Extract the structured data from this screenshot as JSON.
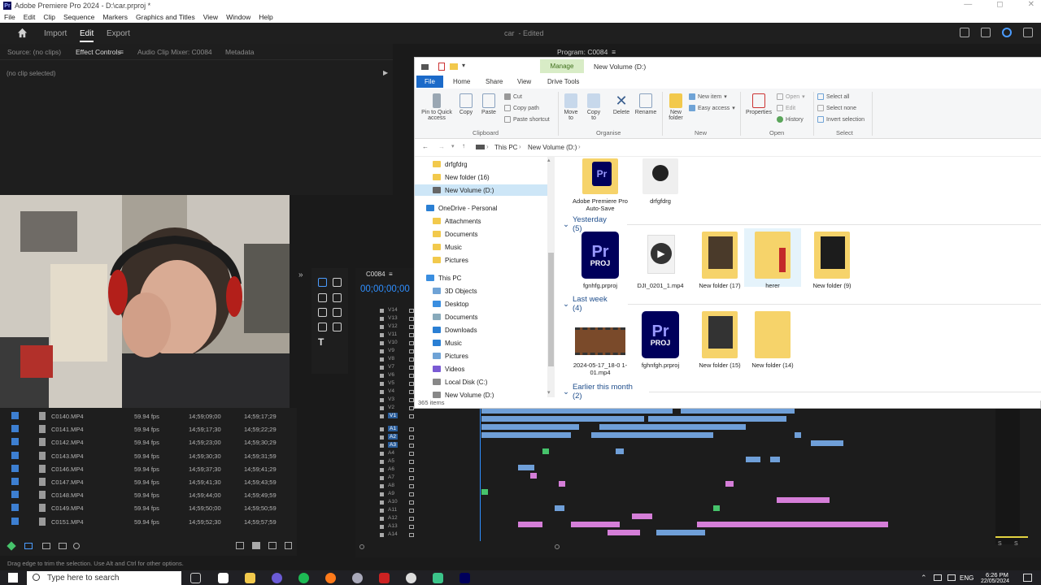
{
  "premiere": {
    "title": "Adobe Premiere Pro 2024 - D:\\car.prproj *",
    "menu": [
      "File",
      "Edit",
      "Clip",
      "Sequence",
      "Markers",
      "Graphics and Titles",
      "View",
      "Window",
      "Help"
    ],
    "workspaces": {
      "import": "Import",
      "edit": "Edit",
      "export": "Export"
    },
    "project_name": "car",
    "project_state": "- Edited",
    "panel_tabs": {
      "source": "Source: (no clips)",
      "effect_controls": "Effect Controls",
      "audio_mixer": "Audio Clip Mixer: C0084",
      "metadata": "Metadata"
    },
    "no_clip": "(no clip selected)",
    "program_label": "Program: C0084",
    "timeline": {
      "sequence_tab": "C0084",
      "timecode": "00;00;00;00",
      "video_tracks": [
        "V14",
        "V13",
        "V12",
        "V11",
        "V10",
        "V9",
        "V8",
        "V7",
        "V6",
        "V5",
        "V4",
        "V3",
        "V2",
        "V1"
      ],
      "audio_tracks": [
        "A1",
        "A2",
        "A3",
        "A4",
        "A5",
        "A6",
        "A7",
        "A8",
        "A9",
        "A10",
        "A11",
        "A12",
        "A13",
        "A14"
      ]
    },
    "bin": {
      "rows": [
        {
          "name": "C0140.MP4",
          "fps": "59.94 fps",
          "in": "14;59;09;00",
          "out": "14;59;17;29"
        },
        {
          "name": "C0141.MP4",
          "fps": "59.94 fps",
          "in": "14;59;17;30",
          "out": "14;59;22;29"
        },
        {
          "name": "C0142.MP4",
          "fps": "59.94 fps",
          "in": "14;59;23;00",
          "out": "14;59;30;29"
        },
        {
          "name": "C0143.MP4",
          "fps": "59.94 fps",
          "in": "14;59;30;30",
          "out": "14;59;31;59"
        },
        {
          "name": "C0146.MP4",
          "fps": "59.94 fps",
          "in": "14;59;37;30",
          "out": "14;59;41;29"
        },
        {
          "name": "C0147.MP4",
          "fps": "59.94 fps",
          "in": "14;59;41;30",
          "out": "14;59;43;59"
        },
        {
          "name": "C0148.MP4",
          "fps": "59.94 fps",
          "in": "14;59;44;00",
          "out": "14;59;49;59"
        },
        {
          "name": "C0149.MP4",
          "fps": "59.94 fps",
          "in": "14;59;50;00",
          "out": "14;59;50;59"
        },
        {
          "name": "C0151.MP4",
          "fps": "59.94 fps",
          "in": "14;59;52;30",
          "out": "14;59;57;59"
        }
      ]
    },
    "status_bar": "Drag edge to trim the selection. Use Alt and Ctrl for other options.",
    "meter_labels": [
      "S",
      "S"
    ]
  },
  "explorer": {
    "manage_tab": "Manage",
    "title": "New Volume (D:)",
    "tabs": {
      "file": "File",
      "home": "Home",
      "share": "Share",
      "view": "View",
      "drive_tools": "Drive Tools"
    },
    "ribbon": {
      "pin": "Pin to Quick access",
      "copy": "Copy",
      "paste": "Paste",
      "cut": "Cut",
      "copy_path": "Copy path",
      "paste_shortcut": "Paste shortcut",
      "move_to": "Move to",
      "copy_to": "Copy to",
      "delete": "Delete",
      "rename": "Rename",
      "new_folder": "New folder",
      "new_item": "New item",
      "easy_access": "Easy access",
      "properties": "Properties",
      "open": "Open",
      "edit": "Edit",
      "history": "History",
      "select_all": "Select all",
      "select_none": "Select none",
      "invert_selection": "Invert selection",
      "groups": {
        "clipboard": "Clipboard",
        "organise": "Organise",
        "new": "New",
        "open": "Open",
        "select": "Select"
      }
    },
    "address": {
      "this_pc": "This PC",
      "volume": "New Volume (D:)"
    },
    "nav": {
      "top": [
        "drfgfdrg",
        "New folder (16)",
        "New Volume (D:)"
      ],
      "onedrive": "OneDrive - Personal",
      "onedrive_items": [
        "Attachments",
        "Documents",
        "Music",
        "Pictures"
      ],
      "this_pc": "This PC",
      "pc_items": [
        "3D Objects",
        "Desktop",
        "Documents",
        "Downloads",
        "Music",
        "Pictures",
        "Videos",
        "Local Disk (C:)",
        "New Volume (D:)"
      ]
    },
    "groups": {
      "top_items": [
        "Adobe Premiere Pro Auto-Save",
        "drfgfdrg"
      ],
      "yesterday": "Yesterday (5)",
      "yesterday_items": [
        "fgnhfg.prproj",
        "DJI_0201_1.mp4",
        "New folder (17)",
        "herer",
        "New folder (9)"
      ],
      "last_week": "Last week (4)",
      "last_week_items": [
        "2024-05-17_18-0 1-01.mp4",
        "fghnfgh.prproj",
        "New folder (15)",
        "New folder (14)"
      ],
      "earlier": "Earlier this month (2)"
    },
    "item_count": "365 items",
    "proj_badge": {
      "pr": "Pr",
      "proj": "PROJ"
    }
  },
  "taskbar": {
    "search_placeholder": "Type here to search",
    "lang": "ENG",
    "time": "6:26 PM",
    "date": "22/05/2024"
  },
  "colors": {
    "accent_blue": "#2f8fff",
    "clip_blue": "#6f9fd8",
    "clip_pink": "#d57ed8",
    "clip_green": "#46c36b",
    "explorer_file_tab": "#1b6ac9",
    "folder": "#f6d36a"
  }
}
